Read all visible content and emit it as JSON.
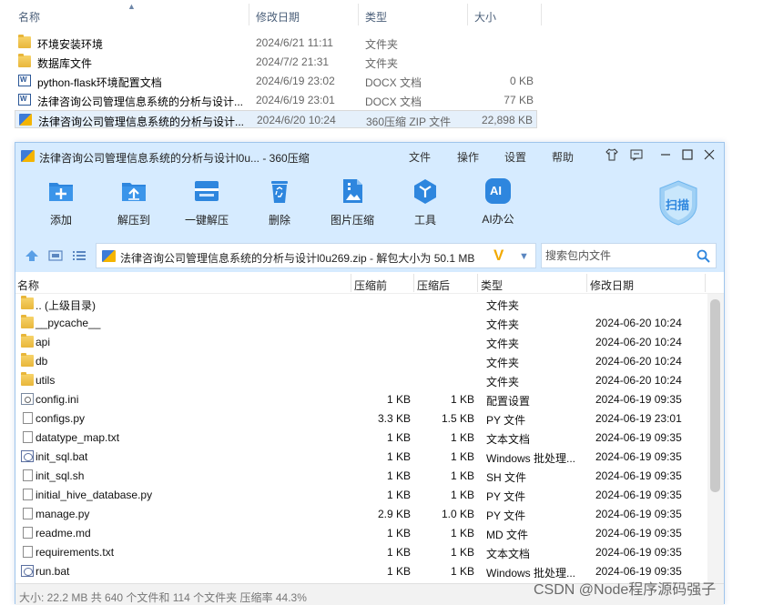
{
  "explorer": {
    "columns": {
      "name": "名称",
      "modified": "修改日期",
      "type": "类型",
      "size": "大小"
    },
    "rows": [
      {
        "icon": "folder-icon",
        "name": "环境安装环境",
        "date": "2024/6/21 11:11",
        "type": "文件夹",
        "size": ""
      },
      {
        "icon": "folder-icon",
        "name": "数据库文件",
        "date": "2024/7/2 21:31",
        "type": "文件夹",
        "size": ""
      },
      {
        "icon": "docx-icon",
        "name": "python-flask环境配置文档",
        "date": "2024/6/19 23:02",
        "type": "DOCX 文档",
        "size": "0 KB"
      },
      {
        "icon": "docx-icon",
        "name": "法律咨询公司管理信息系统的分析与设计...",
        "date": "2024/6/19 23:01",
        "type": "DOCX 文档",
        "size": "77 KB"
      },
      {
        "icon": "zip-icon",
        "name": "法律咨询公司管理信息系统的分析与设计...",
        "date": "2024/6/20 10:24",
        "type": "360压缩 ZIP 文件",
        "size": "22,898 KB"
      }
    ]
  },
  "window": {
    "title": "法律咨询公司管理信息系统的分析与设计l0u... - 360压缩",
    "menu": {
      "file": "文件",
      "operate": "操作",
      "settings": "设置",
      "help": "帮助"
    },
    "toolbar": {
      "add": "添加",
      "extract_to": "解压到",
      "one_click_extract": "一键解压",
      "delete": "删除",
      "image_compress": "图片压缩",
      "tools": "工具",
      "ai_office": "AI办公",
      "ai_badge": "AI",
      "scan": "扫描"
    },
    "address": {
      "path": "法律咨询公司管理信息系统的分析与设计l0u269.zip - 解包大小为 50.1 MB",
      "vlogo": "V",
      "search_placeholder": "搜索包内文件"
    },
    "list": {
      "headers": {
        "name": "名称",
        "before": "压缩前",
        "after": "压缩后",
        "type": "类型",
        "modified": "修改日期"
      },
      "rows": [
        {
          "icon": "folder",
          "name": ".. (上级目录)",
          "before": "",
          "after": "",
          "type": "文件夹",
          "date": ""
        },
        {
          "icon": "folder",
          "name": "__pycache__",
          "before": "",
          "after": "",
          "type": "文件夹",
          "date": "2024-06-20 10:24"
        },
        {
          "icon": "folder",
          "name": "api",
          "before": "",
          "after": "",
          "type": "文件夹",
          "date": "2024-06-20 10:24"
        },
        {
          "icon": "folder",
          "name": "db",
          "before": "",
          "after": "",
          "type": "文件夹",
          "date": "2024-06-20 10:24"
        },
        {
          "icon": "folder",
          "name": "utils",
          "before": "",
          "after": "",
          "type": "文件夹",
          "date": "2024-06-20 10:24"
        },
        {
          "icon": "ini",
          "name": "config.ini",
          "before": "1 KB",
          "after": "1 KB",
          "type": "配置设置",
          "date": "2024-06-19 09:35"
        },
        {
          "icon": "file",
          "name": "configs.py",
          "before": "3.3 KB",
          "after": "1.5 KB",
          "type": "PY 文件",
          "date": "2024-06-19 23:01"
        },
        {
          "icon": "file",
          "name": "datatype_map.txt",
          "before": "1 KB",
          "after": "1 KB",
          "type": "文本文档",
          "date": "2024-06-19 09:35"
        },
        {
          "icon": "bat",
          "name": "init_sql.bat",
          "before": "1 KB",
          "after": "1 KB",
          "type": "Windows 批处理...",
          "date": "2024-06-19 09:35"
        },
        {
          "icon": "file",
          "name": "init_sql.sh",
          "before": "1 KB",
          "after": "1 KB",
          "type": "SH 文件",
          "date": "2024-06-19 09:35"
        },
        {
          "icon": "file",
          "name": "initial_hive_database.py",
          "before": "1 KB",
          "after": "1 KB",
          "type": "PY 文件",
          "date": "2024-06-19 09:35"
        },
        {
          "icon": "file",
          "name": "manage.py",
          "before": "2.9 KB",
          "after": "1.0 KB",
          "type": "PY 文件",
          "date": "2024-06-19 09:35"
        },
        {
          "icon": "file",
          "name": "readme.md",
          "before": "1 KB",
          "after": "1 KB",
          "type": "MD 文件",
          "date": "2024-06-19 09:35"
        },
        {
          "icon": "file",
          "name": "requirements.txt",
          "before": "1 KB",
          "after": "1 KB",
          "type": "文本文档",
          "date": "2024-06-19 09:35"
        },
        {
          "icon": "bat",
          "name": "run.bat",
          "before": "1 KB",
          "after": "1 KB",
          "type": "Windows 批处理...",
          "date": "2024-06-19 09:35"
        }
      ]
    },
    "status": "大小: 22.2 MB 共 640 个文件和 114 个文件夹 压缩率 44.3%"
  },
  "watermark": "CSDN @Node程序源码强子",
  "colors": {
    "chrome": "#d6ebff",
    "accent": "#2e86de",
    "folder": "#f0c24b"
  }
}
